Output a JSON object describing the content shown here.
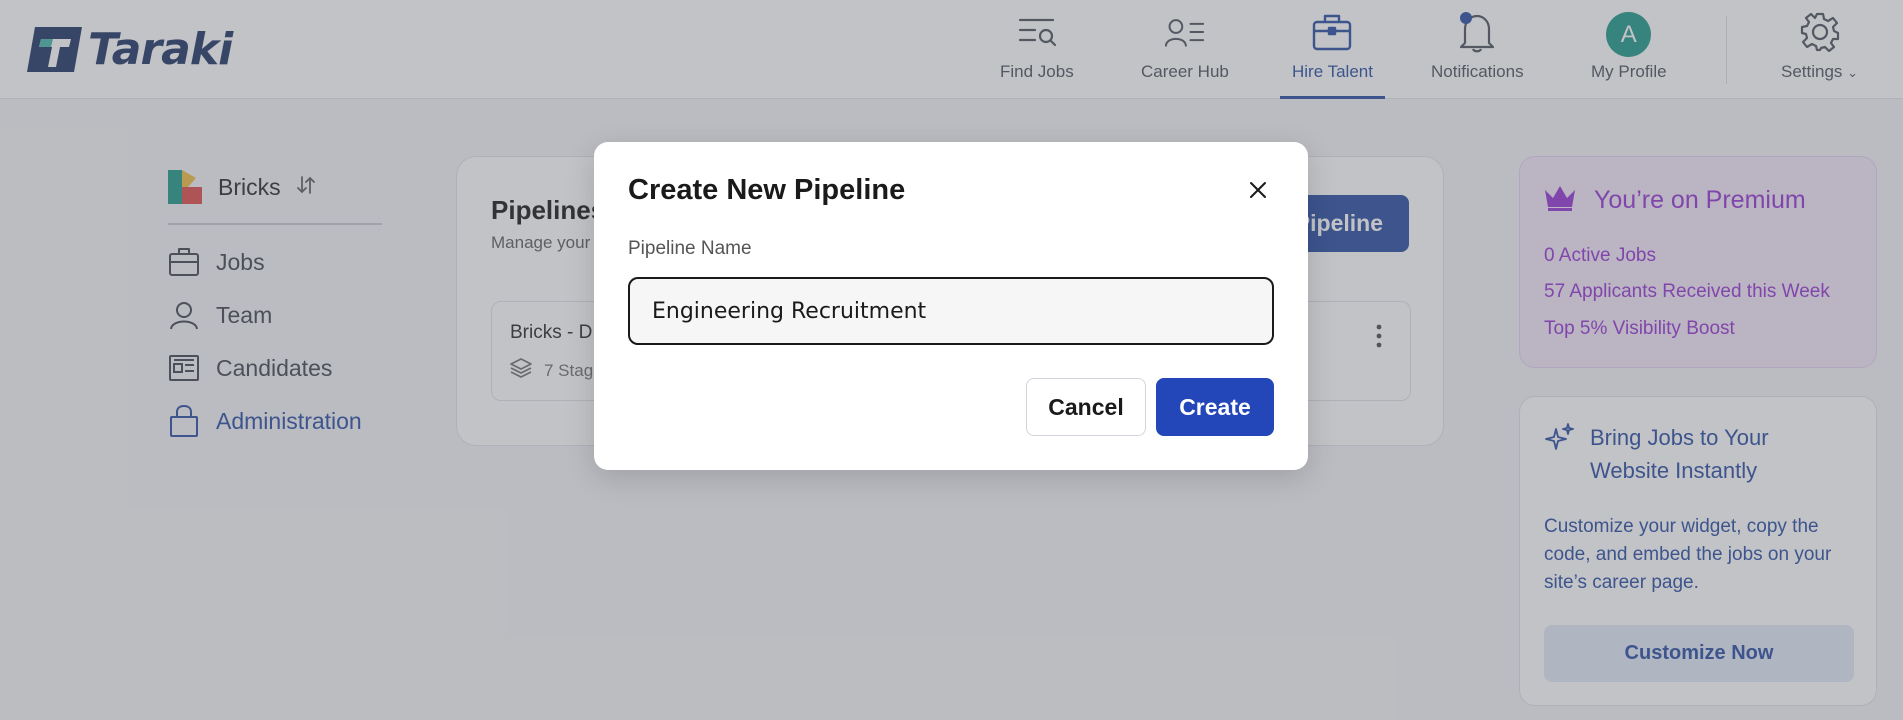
{
  "app": {
    "name": "Taraki"
  },
  "nav": {
    "items": [
      {
        "label": "Find Jobs",
        "icon": "find-jobs-icon"
      },
      {
        "label": "Career Hub",
        "icon": "career-hub-icon"
      },
      {
        "label": "Hire Talent",
        "icon": "briefcase-icon",
        "active": true
      },
      {
        "label": "Notifications",
        "icon": "bell-icon"
      },
      {
        "label": "My Profile",
        "icon": "avatar"
      }
    ],
    "avatar_initial": "A",
    "settings_label": "Settings"
  },
  "sidebar": {
    "company": "Bricks",
    "items": [
      {
        "label": "Jobs",
        "icon": "briefcase-icon"
      },
      {
        "label": "Team",
        "icon": "user-icon"
      },
      {
        "label": "Candidates",
        "icon": "id-card-icon"
      },
      {
        "label": "Administration",
        "icon": "lock-icon",
        "active": true
      }
    ]
  },
  "main": {
    "title": "Pipelines",
    "subtitle": "Manage your",
    "add_button_label": "Pipeline",
    "pipeline": {
      "name": "Bricks - D",
      "stages": "7 Stag"
    }
  },
  "premium": {
    "title": "You’re on Premium",
    "lines": [
      "0 Active Jobs",
      "57 Applicants Received this Week",
      "Top 5% Visibility Boost"
    ]
  },
  "widget": {
    "title": "Bring Jobs to Your Website Instantly",
    "body": "Customize your widget, copy the code, and embed the jobs on your site’s career page.",
    "button_label": "Customize Now"
  },
  "modal": {
    "title": "Create New Pipeline",
    "field_label": "Pipeline Name",
    "field_value": "Engineering Recruitment",
    "cancel_label": "Cancel",
    "create_label": "Create"
  },
  "colors": {
    "brand": "#3355a8",
    "premium": "#9b3fd6",
    "create_button": "#2346b8",
    "avatar": "#2a9d8f"
  }
}
